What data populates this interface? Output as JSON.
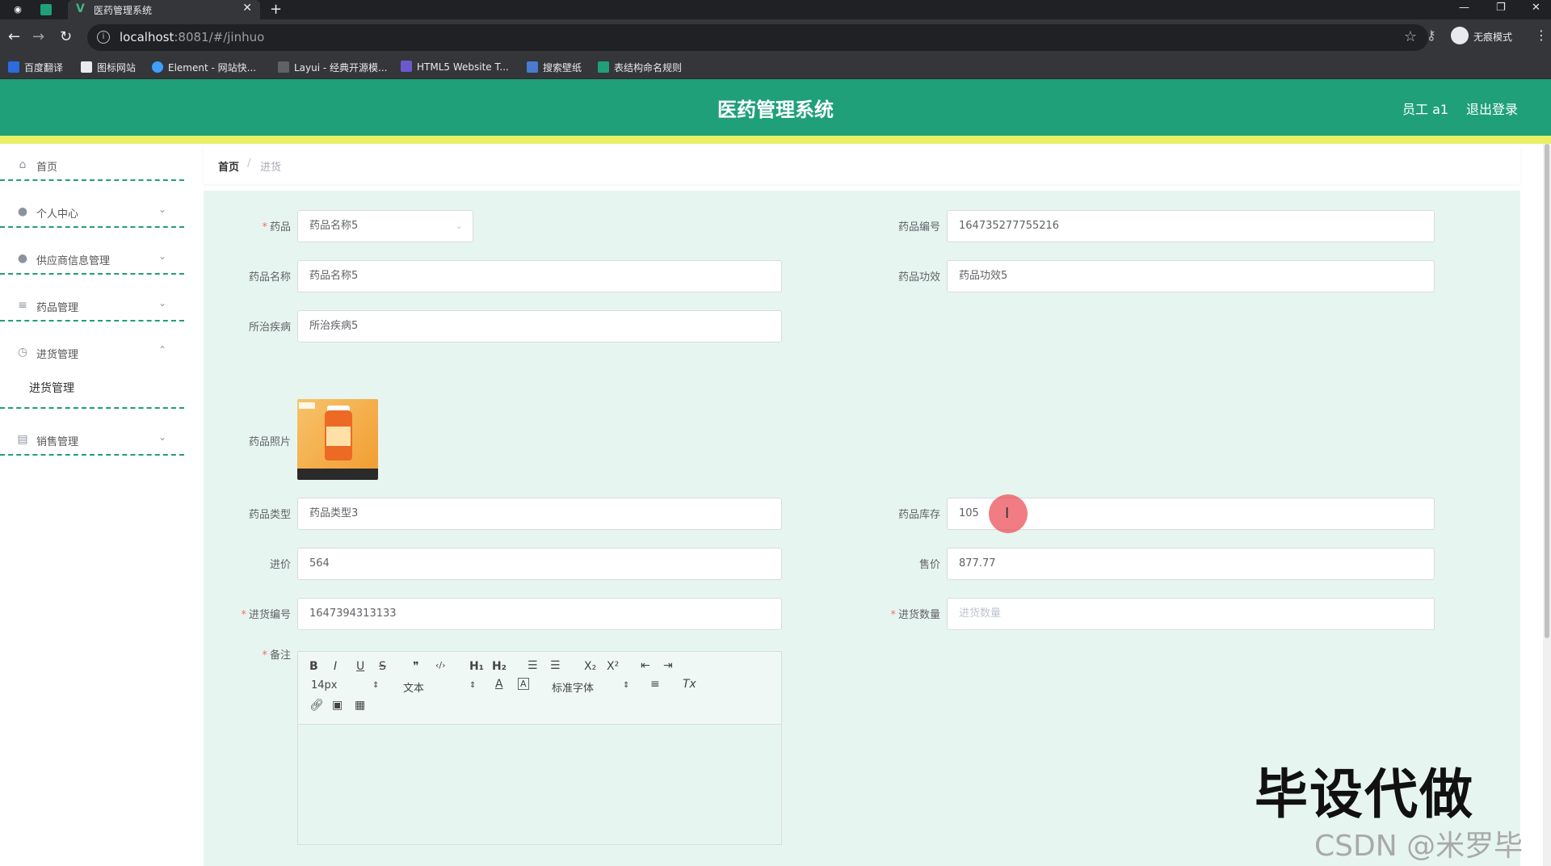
{
  "browser": {
    "tab_title": "医药管理系统",
    "url_host": "localhost",
    "url_rest": ":8081/#/jinhuo",
    "incognito_label": "无痕模式",
    "bookmarks": [
      "百度翻译",
      "图标网站",
      "Element - 网站快...",
      "Layui - 经典开源模...",
      "HTML5 Website T...",
      "搜索壁纸",
      "表结构命名规则"
    ]
  },
  "header": {
    "title": "医药管理系统",
    "user": "员工 a1",
    "logout": "退出登录"
  },
  "sidebar": {
    "items": [
      {
        "label": "首页",
        "icon": "home-icon"
      },
      {
        "label": "个人中心",
        "icon": "user-icon"
      },
      {
        "label": "供应商信息管理",
        "icon": "user-icon"
      },
      {
        "label": "药品管理",
        "icon": "list-icon"
      },
      {
        "label": "进货管理",
        "icon": "clock-icon"
      },
      {
        "label": "销售管理",
        "icon": "box-icon"
      }
    ],
    "submenu_jinhuo": "进货管理"
  },
  "breadcrumb": {
    "home": "首页",
    "separator": "/",
    "current": "进货"
  },
  "form": {
    "drug_label": "药品",
    "drug_value": "药品名称5",
    "code_label": "药品编号",
    "code_value": "164735277755216",
    "name_label": "药品名称",
    "name_value": "药品名称5",
    "effect_label": "药品功效",
    "effect_value": "药品功效5",
    "disease_label": "所治疾病",
    "disease_value": "所治疾病5",
    "photo_label": "药品照片",
    "type_label": "药品类型",
    "type_value": "药品类型3",
    "stock_label": "药品库存",
    "stock_value": "105",
    "cost_label": "进价",
    "cost_value": "564",
    "price_label": "售价",
    "price_value": "877.77",
    "order_label": "进货编号",
    "order_value": "1647394313133",
    "qty_label": "进货数量",
    "qty_placeholder": "进货数量",
    "note_label": "备注",
    "required_mark": "*"
  },
  "editor": {
    "font_size": "14px",
    "text_style": "文本",
    "font_family": "标准字体",
    "buttons": [
      "B",
      "I",
      "U",
      "S",
      "❞",
      "‹/›",
      "H₁",
      "H₂",
      "ordered-list",
      "bullet-list",
      "X₂",
      "X²",
      "outdent",
      "indent",
      "A",
      "Ā",
      "align",
      "T̶x",
      "link",
      "image",
      "video"
    ]
  },
  "watermark": {
    "line1": "毕设代做",
    "line2": "CSDN @米罗毕设"
  },
  "colors": {
    "header_bg": "#1fa079",
    "accent_strip": "#e9f064",
    "form_bg": "#e7f5f0",
    "required": "#f56c6c"
  }
}
